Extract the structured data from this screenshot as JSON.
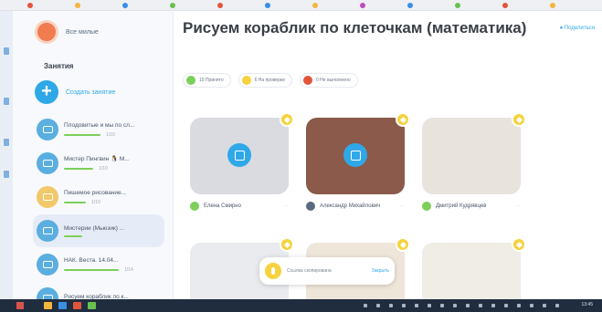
{
  "browser": {
    "strip_dots": [
      "#e2553c",
      "#f5b53e",
      "#3a8ee6",
      "#6ac04f",
      "#e2553c",
      "#3a8ee6",
      "#f5b53e",
      "#c04ac0",
      "#3a8ee6",
      "#6ac04f",
      "#e2553c",
      "#f5b53e"
    ]
  },
  "sidebar": {
    "user_name": "Все милые",
    "section_title": "Занятия",
    "new_lesson_label": "Создать занятие",
    "lessons": [
      {
        "title": "Плодовитые и мы по сл...",
        "meta": "1/10",
        "icon_color": "#5aaee0",
        "bar": 40
      },
      {
        "title": "Мистер Пингвин 🐧 М...",
        "meta": "1/10",
        "icon_color": "#5aaee0",
        "bar": 32
      },
      {
        "title": "Пишемое рисование...",
        "meta": "1/10",
        "icon_color": "#f1c96a",
        "bar": 24
      },
      {
        "title": "Мистерии (Мьюзик) ...",
        "meta": "",
        "icon_color": "#5aaee0",
        "bar": 20
      },
      {
        "title": "НАК. Веста. 14.04...",
        "meta": "1/14",
        "icon_color": "#5aaee0",
        "bar": 60
      },
      {
        "title": "Рисуем кораблик по к...",
        "meta": "",
        "icon_color": "#5aaee0",
        "bar": 0
      }
    ]
  },
  "main": {
    "title": "Рисуем кораблик по клеточкам (математика)",
    "share_label": "● Поделиться",
    "filters": [
      {
        "label": "10 Принято",
        "color": "#7ccf5a"
      },
      {
        "label": "6 На проверке",
        "color": "#f6d23d"
      },
      {
        "label": "0 Не выполнено",
        "color": "#e2553c"
      }
    ],
    "cards": [
      {
        "author": "Елена Смирно",
        "author_color": "#7ccf5a",
        "more": "···",
        "has_play": true,
        "bg": "#d9dbe0"
      },
      {
        "author": "Александр Михайлович",
        "author_color": "#5a6b80",
        "more": "···",
        "has_play": true,
        "bg": "#8b5a4a"
      },
      {
        "author": "Дмитрий Кудрявцев",
        "author_color": "#7ccf5a",
        "more": "···",
        "has_play": false,
        "bg": "#e8e4dd"
      },
      {
        "author": "",
        "author_color": "#7ccf5a",
        "more": "",
        "has_play": false,
        "bg": "#e9ebee"
      },
      {
        "author": "",
        "author_color": "#7ccf5a",
        "more": "",
        "has_play": false,
        "bg": "#efe6da"
      },
      {
        "author": "",
        "author_color": "#7ccf5a",
        "more": "",
        "has_play": false,
        "bg": "#f0ece6"
      }
    ]
  },
  "toast": {
    "message": "Ссылка скопирована",
    "action": "Закрыть"
  },
  "taskbar": {
    "clock": "13:45"
  }
}
